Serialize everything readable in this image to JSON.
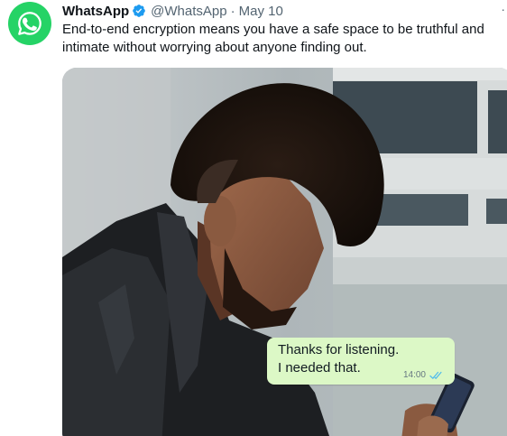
{
  "tweet": {
    "author_name": "WhatsApp",
    "handle": "@WhatsApp",
    "separator": "·",
    "date": "May 10",
    "more_glyph": "·",
    "text": "End-to-end encryption means you have a safe space to be truthful and intimate without worrying about anyone finding out."
  },
  "media": {
    "bubble": {
      "line1": "Thanks for listening.",
      "line2": "I needed that.",
      "time": "14:00"
    }
  },
  "colors": {
    "brand_green": "#25d366",
    "verified_blue": "#1d9bf0",
    "bubble_green": "#dcf8c6",
    "read_ticks": "#53bdeb"
  },
  "icons": {
    "avatar": "whatsapp-logo-icon",
    "verified": "verified-badge-icon",
    "ticks": "double-check-icon"
  }
}
